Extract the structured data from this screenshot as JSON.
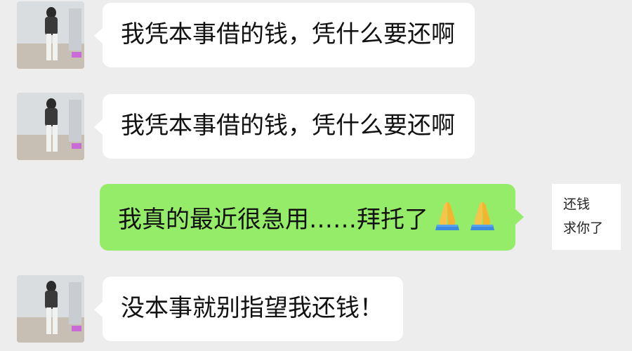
{
  "messages": [
    {
      "sender": "other",
      "text": "我凭本事借的钱，凭什么要还啊"
    },
    {
      "sender": "other",
      "text": "我凭本事借的钱，凭什么要还啊"
    },
    {
      "sender": "self",
      "text": "我真的最近很急用……拜托了",
      "emoji": [
        "folded-hands-icon",
        "folded-hands-icon"
      ]
    },
    {
      "sender": "other",
      "text": "没本事就别指望我还钱！"
    }
  ],
  "side_label": {
    "line1": "还钱",
    "line2": "求你了"
  },
  "colors": {
    "background": "#ededed",
    "incoming_bubble": "#ffffff",
    "outgoing_bubble": "#95ec69"
  }
}
